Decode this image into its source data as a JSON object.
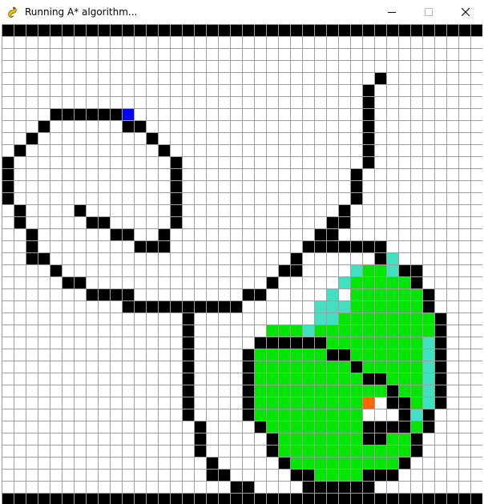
{
  "window": {
    "title": "Running A* algorithm...",
    "app_icon": "pygame-snake-icon",
    "controls": {
      "minimize_icon": "minimize-icon",
      "maximize_icon": "maximize-icon",
      "close_icon": "close-icon"
    }
  },
  "grid": {
    "rows": 40,
    "cols": 40,
    "colors": {
      "empty": "#ffffff",
      "grid_line": "#9e9e9e",
      "barrier": "#000000",
      "closed": "#00e600",
      "open": "#40e0c0",
      "start": "#0000ff",
      "current": "#ff6600"
    },
    "start": [
      7,
      10
    ],
    "current": [
      31,
      30
    ],
    "barrier_segments": [
      [
        0,
        0,
        39
      ],
      [
        39,
        0,
        39
      ],
      [
        4,
        31,
        31
      ],
      [
        5,
        30,
        30
      ],
      [
        6,
        30,
        30
      ],
      [
        7,
        4,
        9
      ],
      [
        7,
        30,
        30
      ],
      [
        8,
        3,
        3
      ],
      [
        8,
        10,
        11
      ],
      [
        8,
        30,
        30
      ],
      [
        9,
        2,
        2
      ],
      [
        9,
        12,
        12
      ],
      [
        9,
        30,
        30
      ],
      [
        10,
        1,
        1
      ],
      [
        10,
        13,
        13
      ],
      [
        10,
        30,
        30
      ],
      [
        11,
        0,
        0
      ],
      [
        11,
        14,
        14
      ],
      [
        11,
        30,
        30
      ],
      [
        12,
        0,
        0
      ],
      [
        12,
        14,
        14
      ],
      [
        12,
        29,
        29
      ],
      [
        13,
        0,
        0
      ],
      [
        13,
        14,
        14
      ],
      [
        13,
        29,
        29
      ],
      [
        14,
        0,
        0
      ],
      [
        14,
        14,
        14
      ],
      [
        14,
        29,
        29
      ],
      [
        15,
        1,
        1
      ],
      [
        15,
        6,
        6
      ],
      [
        15,
        14,
        14
      ],
      [
        15,
        28,
        28
      ],
      [
        16,
        1,
        1
      ],
      [
        16,
        7,
        8
      ],
      [
        16,
        14,
        14
      ],
      [
        16,
        27,
        28
      ],
      [
        17,
        2,
        2
      ],
      [
        17,
        9,
        10
      ],
      [
        17,
        13,
        13
      ],
      [
        17,
        26,
        27
      ],
      [
        18,
        2,
        2
      ],
      [
        18,
        11,
        13
      ],
      [
        18,
        25,
        31
      ],
      [
        19,
        2,
        3
      ],
      [
        19,
        24,
        24
      ],
      [
        19,
        31,
        31
      ],
      [
        20,
        4,
        4
      ],
      [
        20,
        23,
        24
      ],
      [
        20,
        33,
        34
      ],
      [
        21,
        5,
        6
      ],
      [
        21,
        22,
        22
      ],
      [
        21,
        34,
        34
      ],
      [
        22,
        7,
        10
      ],
      [
        22,
        20,
        21
      ],
      [
        22,
        35,
        35
      ],
      [
        23,
        10,
        17
      ],
      [
        23,
        18,
        19
      ],
      [
        23,
        35,
        35
      ],
      [
        24,
        15,
        15
      ],
      [
        24,
        36,
        36
      ],
      [
        25,
        15,
        15
      ],
      [
        25,
        36,
        36
      ],
      [
        26,
        15,
        15
      ],
      [
        26,
        21,
        26
      ],
      [
        26,
        36,
        36
      ],
      [
        27,
        15,
        15
      ],
      [
        27,
        20,
        20
      ],
      [
        27,
        27,
        28
      ],
      [
        27,
        36,
        36
      ],
      [
        28,
        15,
        15
      ],
      [
        28,
        20,
        20
      ],
      [
        28,
        29,
        29
      ],
      [
        28,
        36,
        36
      ],
      [
        29,
        15,
        15
      ],
      [
        29,
        20,
        20
      ],
      [
        29,
        30,
        31
      ],
      [
        29,
        36,
        36
      ],
      [
        30,
        15,
        15
      ],
      [
        30,
        20,
        20
      ],
      [
        30,
        32,
        32
      ],
      [
        30,
        36,
        36
      ],
      [
        31,
        15,
        15
      ],
      [
        31,
        20,
        20
      ],
      [
        31,
        32,
        33
      ],
      [
        31,
        36,
        36
      ],
      [
        32,
        15,
        15
      ],
      [
        32,
        20,
        20
      ],
      [
        32,
        33,
        33
      ],
      [
        32,
        35,
        35
      ],
      [
        33,
        16,
        16
      ],
      [
        33,
        21,
        21
      ],
      [
        33,
        30,
        33
      ],
      [
        33,
        35,
        35
      ],
      [
        34,
        16,
        16
      ],
      [
        34,
        22,
        22
      ],
      [
        34,
        30,
        31
      ],
      [
        34,
        34,
        34
      ],
      [
        35,
        16,
        16
      ],
      [
        35,
        22,
        22
      ],
      [
        35,
        34,
        34
      ],
      [
        36,
        17,
        17
      ],
      [
        36,
        23,
        23
      ],
      [
        36,
        33,
        33
      ],
      [
        37,
        17,
        18
      ],
      [
        37,
        24,
        25
      ],
      [
        37,
        30,
        32
      ],
      [
        38,
        19,
        20
      ],
      [
        38,
        25,
        30
      ]
    ],
    "closed_segments": [
      [
        20,
        30,
        31
      ],
      [
        21,
        29,
        33
      ],
      [
        22,
        29,
        34
      ],
      [
        23,
        28,
        34
      ],
      [
        24,
        28,
        35
      ],
      [
        25,
        22,
        27
      ],
      [
        25,
        28,
        35
      ],
      [
        26,
        27,
        35
      ],
      [
        27,
        21,
        26
      ],
      [
        27,
        29,
        35
      ],
      [
        28,
        21,
        28
      ],
      [
        28,
        30,
        34
      ],
      [
        29,
        21,
        29
      ],
      [
        29,
        32,
        34
      ],
      [
        30,
        21,
        31
      ],
      [
        30,
        33,
        34
      ],
      [
        31,
        21,
        30
      ],
      [
        31,
        34,
        34
      ],
      [
        32,
        21,
        29
      ],
      [
        32,
        34,
        34
      ],
      [
        33,
        22,
        29
      ],
      [
        33,
        34,
        34
      ],
      [
        34,
        23,
        29
      ],
      [
        34,
        32,
        33
      ],
      [
        35,
        23,
        33
      ],
      [
        36,
        24,
        32
      ],
      [
        37,
        26,
        29
      ]
    ],
    "open_segments": [
      [
        19,
        32,
        32
      ],
      [
        20,
        29,
        29
      ],
      [
        20,
        32,
        32
      ],
      [
        21,
        28,
        28
      ],
      [
        22,
        27,
        27
      ],
      [
        23,
        26,
        28
      ],
      [
        24,
        26,
        27
      ],
      [
        25,
        25,
        25
      ],
      [
        26,
        35,
        35
      ],
      [
        27,
        35,
        35
      ],
      [
        28,
        35,
        35
      ],
      [
        29,
        35,
        35
      ],
      [
        30,
        35,
        35
      ],
      [
        31,
        35,
        35
      ],
      [
        32,
        34,
        34
      ]
    ]
  }
}
